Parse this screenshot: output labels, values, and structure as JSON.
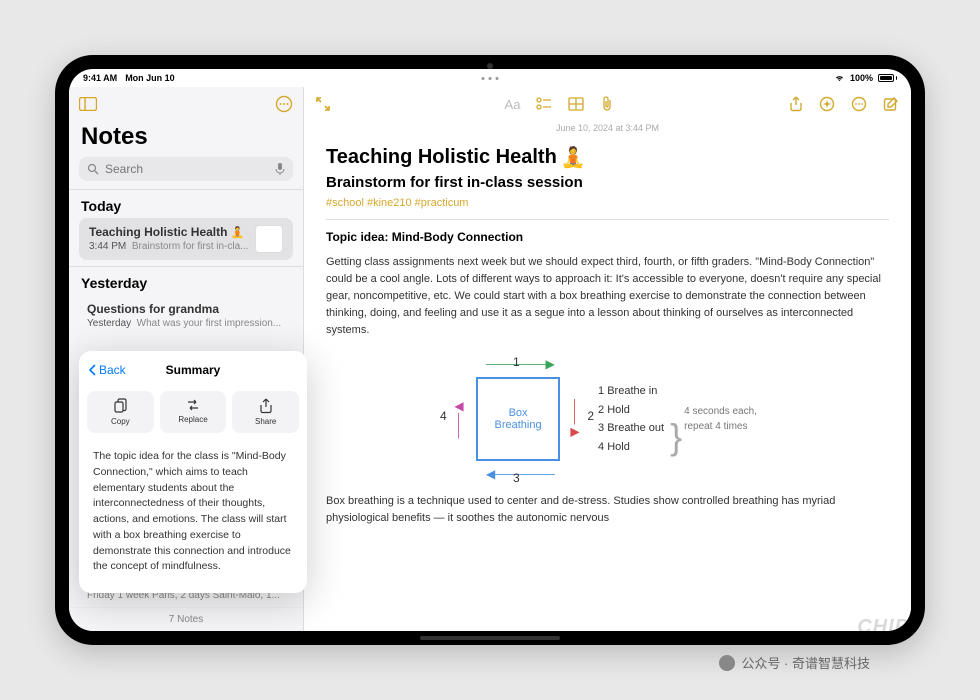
{
  "status": {
    "time": "9:41 AM",
    "date": "Mon Jun 10",
    "battery": "100%"
  },
  "sidebar": {
    "title": "Notes",
    "search_placeholder": "Search",
    "sections": {
      "today": "Today",
      "yesterday": "Yesterday"
    },
    "notes": [
      {
        "title": "Teaching Holistic Health",
        "emoji": "🧘",
        "time": "3:44 PM",
        "preview": "Brainstorm for first in-cla..."
      },
      {
        "title": "Questions for grandma",
        "time": "Yesterday",
        "preview": "What was your first impression..."
      }
    ],
    "truncated_row": "Friday  1 week Paris, 2 days Saint-Malo, 1...",
    "count": "7 Notes"
  },
  "popover": {
    "back": "Back",
    "title": "Summary",
    "actions": {
      "copy": "Copy",
      "replace": "Replace",
      "share": "Share"
    },
    "body": "The topic idea for the class is \"Mind-Body Connection,\" which aims to teach elementary students about the interconnectedness of their thoughts, actions, and emotions. The class will start with a box breathing exercise to demonstrate this connection and introduce the concept of mindfulness."
  },
  "note": {
    "meta": "June 10, 2024 at 3:44 PM",
    "title": "Teaching Holistic Health",
    "emoji": "🧘",
    "subtitle": "Brainstorm for first in-class session",
    "tags": "#school #kine210 #practicum",
    "heading": "Topic idea: Mind-Body Connection",
    "para1": "Getting class assignments next week but we should expect third, fourth, or fifth graders. \"Mind-Body Connection\" could be a cool angle. Lots of different ways to approach it: It's accessible to everyone, doesn't require any special gear, noncompetitive, etc. We could start with a box breathing exercise to demonstrate the connection between thinking, doing, and feeling and use it as a segue into a lesson about thinking of ourselves as interconnected systems.",
    "sketch": {
      "box_line1": "Box",
      "box_line2": "Breathing",
      "steps": [
        "1  Breathe in",
        "2  Hold",
        "3  Breathe out",
        "4  Hold"
      ],
      "note_line1": "4 seconds each,",
      "note_line2": "repeat 4 times"
    },
    "para2": "Box breathing is a technique used to center and de-stress. Studies show controlled breathing has myriad physiological benefits — it soothes the autonomic nervous"
  },
  "overlay": {
    "label": "公众号 · 奇谱智慧科技",
    "chip": "CHIP"
  }
}
